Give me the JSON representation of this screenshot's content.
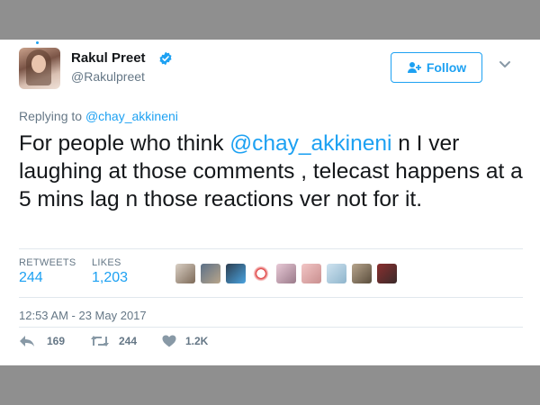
{
  "user": {
    "name": "Rakul Preet",
    "handle": "@Rakulpreet",
    "verified": true,
    "avatar_icon": "profile-photo"
  },
  "follow_button": {
    "label": "Follow",
    "icon": "add-user-icon"
  },
  "menu_icon": "chevron-down-icon",
  "reply_context": {
    "prefix": "Replying to",
    "mention": "@chay_akkineni"
  },
  "tweet": {
    "before_mention": "For people who think ",
    "mention": "@chay_akkineni",
    "after_mention": " n I ver laughing at those comments , telecast happens at a 5 mins lag n those reactions ver not for it."
  },
  "stats": {
    "retweets_label": "RETWEETS",
    "retweets_value": "244",
    "likes_label": "LIKES",
    "likes_value": "1,203"
  },
  "likers_count_shown": 9,
  "timestamp": "12:53 AM - 23 May 2017",
  "actions": {
    "reply_count": "169",
    "retweet_count": "244",
    "like_count": "1.2K"
  },
  "colors": {
    "accent": "#1da1f2",
    "text": "#14171a",
    "muted": "#657786",
    "divider": "#e1e8ed",
    "frame": "#8f8f8f"
  }
}
